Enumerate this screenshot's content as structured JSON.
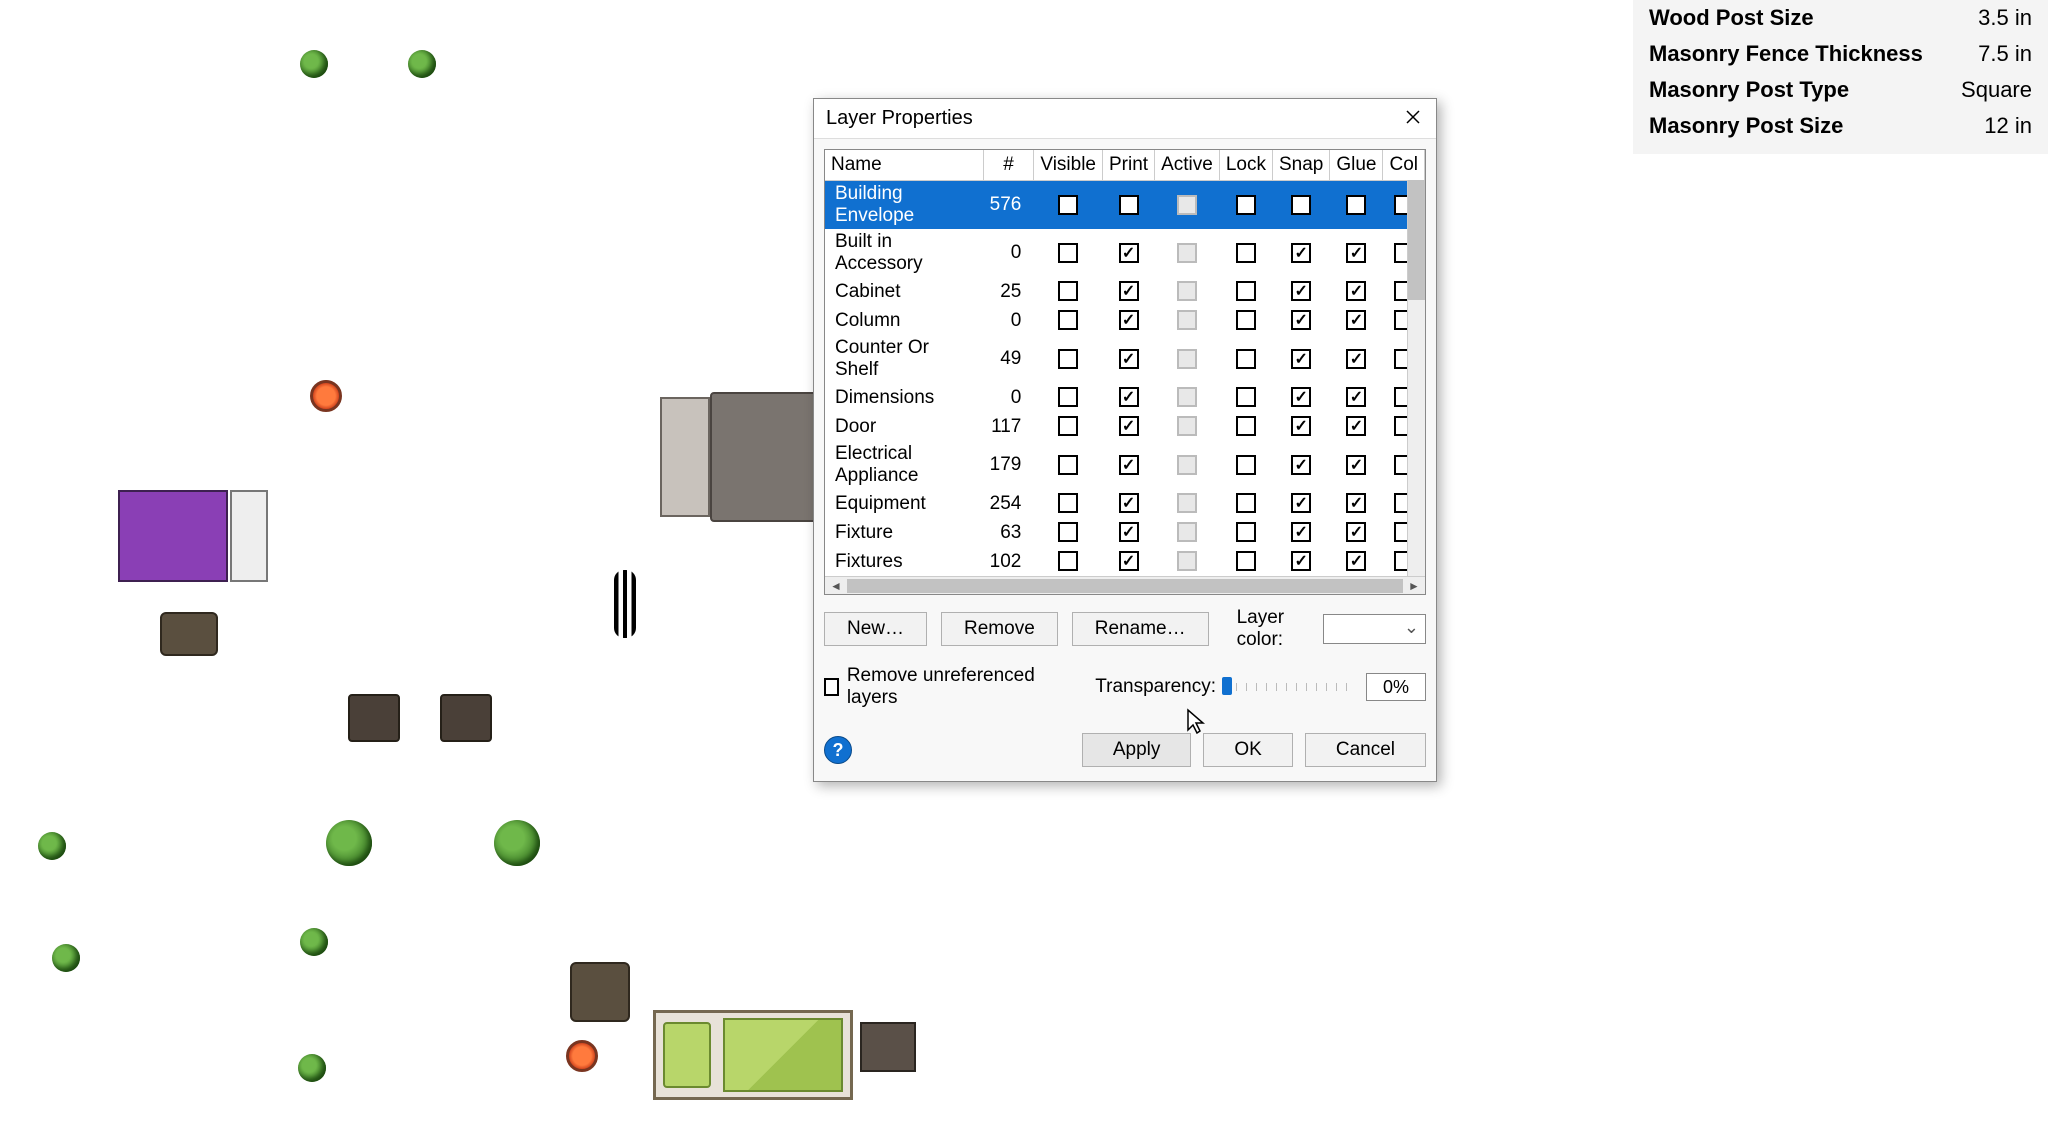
{
  "propPanel": [
    {
      "label": "Wood Post Size",
      "value": "3.5 in"
    },
    {
      "label": "Masonry Fence Thickness",
      "value": "7.5 in"
    },
    {
      "label": "Masonry Post Type",
      "value": "Square"
    },
    {
      "label": "Masonry Post Size",
      "value": "12 in"
    }
  ],
  "dialog": {
    "title": "Layer Properties",
    "columns": [
      "Name",
      "#",
      "Visible",
      "Print",
      "Active",
      "Lock",
      "Snap",
      "Glue",
      "Col"
    ],
    "rows": [
      {
        "name": "Building Envelope",
        "count": 576,
        "visible": false,
        "print": true,
        "active": null,
        "lock": false,
        "snap": true,
        "glue": true,
        "selected": true
      },
      {
        "name": "Built in Accessory",
        "count": 0,
        "visible": false,
        "print": true,
        "active": null,
        "lock": false,
        "snap": true,
        "glue": true,
        "selected": false
      },
      {
        "name": "Cabinet",
        "count": 25,
        "visible": false,
        "print": true,
        "active": null,
        "lock": false,
        "snap": true,
        "glue": true,
        "selected": false
      },
      {
        "name": "Column",
        "count": 0,
        "visible": false,
        "print": true,
        "active": null,
        "lock": false,
        "snap": true,
        "glue": true,
        "selected": false
      },
      {
        "name": "Counter Or Shelf",
        "count": 49,
        "visible": false,
        "print": true,
        "active": null,
        "lock": false,
        "snap": true,
        "glue": true,
        "selected": false
      },
      {
        "name": "Dimensions",
        "count": 0,
        "visible": false,
        "print": true,
        "active": null,
        "lock": false,
        "snap": true,
        "glue": true,
        "selected": false
      },
      {
        "name": "Door",
        "count": 117,
        "visible": false,
        "print": true,
        "active": null,
        "lock": false,
        "snap": true,
        "glue": true,
        "selected": false
      },
      {
        "name": "Electrical Appliance",
        "count": 179,
        "visible": false,
        "print": true,
        "active": null,
        "lock": false,
        "snap": true,
        "glue": true,
        "selected": false
      },
      {
        "name": "Equipment",
        "count": 254,
        "visible": false,
        "print": true,
        "active": null,
        "lock": false,
        "snap": true,
        "glue": true,
        "selected": false
      },
      {
        "name": "Fixture",
        "count": 63,
        "visible": false,
        "print": true,
        "active": null,
        "lock": false,
        "snap": true,
        "glue": true,
        "selected": false
      },
      {
        "name": "Fixtures",
        "count": 102,
        "visible": false,
        "print": true,
        "active": null,
        "lock": false,
        "snap": true,
        "glue": true,
        "selected": false
      }
    ],
    "buttons": {
      "new": "New…",
      "remove": "Remove",
      "rename": "Rename…"
    },
    "layerColorLabel": "Layer color:",
    "removeUnref": "Remove unreferenced layers",
    "transparencyLabel": "Transparency:",
    "transparencyValue": "0%",
    "apply": "Apply",
    "ok": "OK",
    "cancel": "Cancel"
  }
}
